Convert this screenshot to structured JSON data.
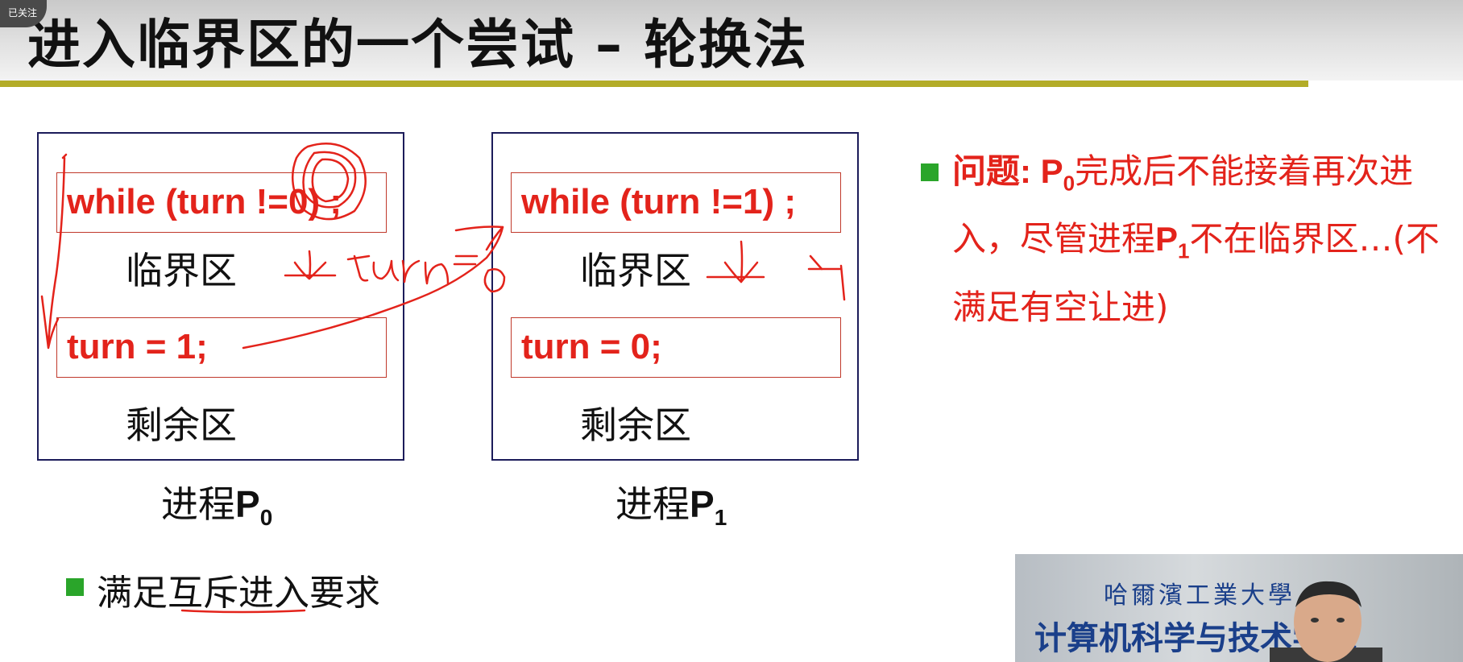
{
  "badge": "已关注",
  "title": "进入临界区的一个尝试 – 轮换法",
  "p0": {
    "entry_code": "while (turn !=0) ;",
    "critical_label": "临界区",
    "exit_code": "turn = 1;",
    "remainder_label": "剩余区",
    "caption_prefix": "进程",
    "caption_name": "P",
    "caption_sub": "0"
  },
  "p1": {
    "entry_code": "while (turn !=1) ;",
    "critical_label": "临界区",
    "exit_code": "turn = 0;",
    "remainder_label": "剩余区",
    "caption_prefix": "进程",
    "caption_name": "P",
    "caption_sub": "1"
  },
  "problem": {
    "label": "问题: ",
    "p0_name": "P",
    "p0_sub": "0",
    "text_a": "完成后不能接着再次进入，尽管进程",
    "p1_name": "P",
    "p1_sub": "1",
    "text_b": "不在临界区…(不满足有空让进)"
  },
  "mutex_note": "满足互斥进入要求",
  "video": {
    "school_line": "哈爾濱工業大學",
    "dept_line": "计算机科学与技术学院"
  },
  "colors": {
    "accent_red": "#e3231b",
    "bullet_green": "#2aa52a",
    "title_rule": "#b3ac28",
    "box_border": "#1c1c5a"
  }
}
